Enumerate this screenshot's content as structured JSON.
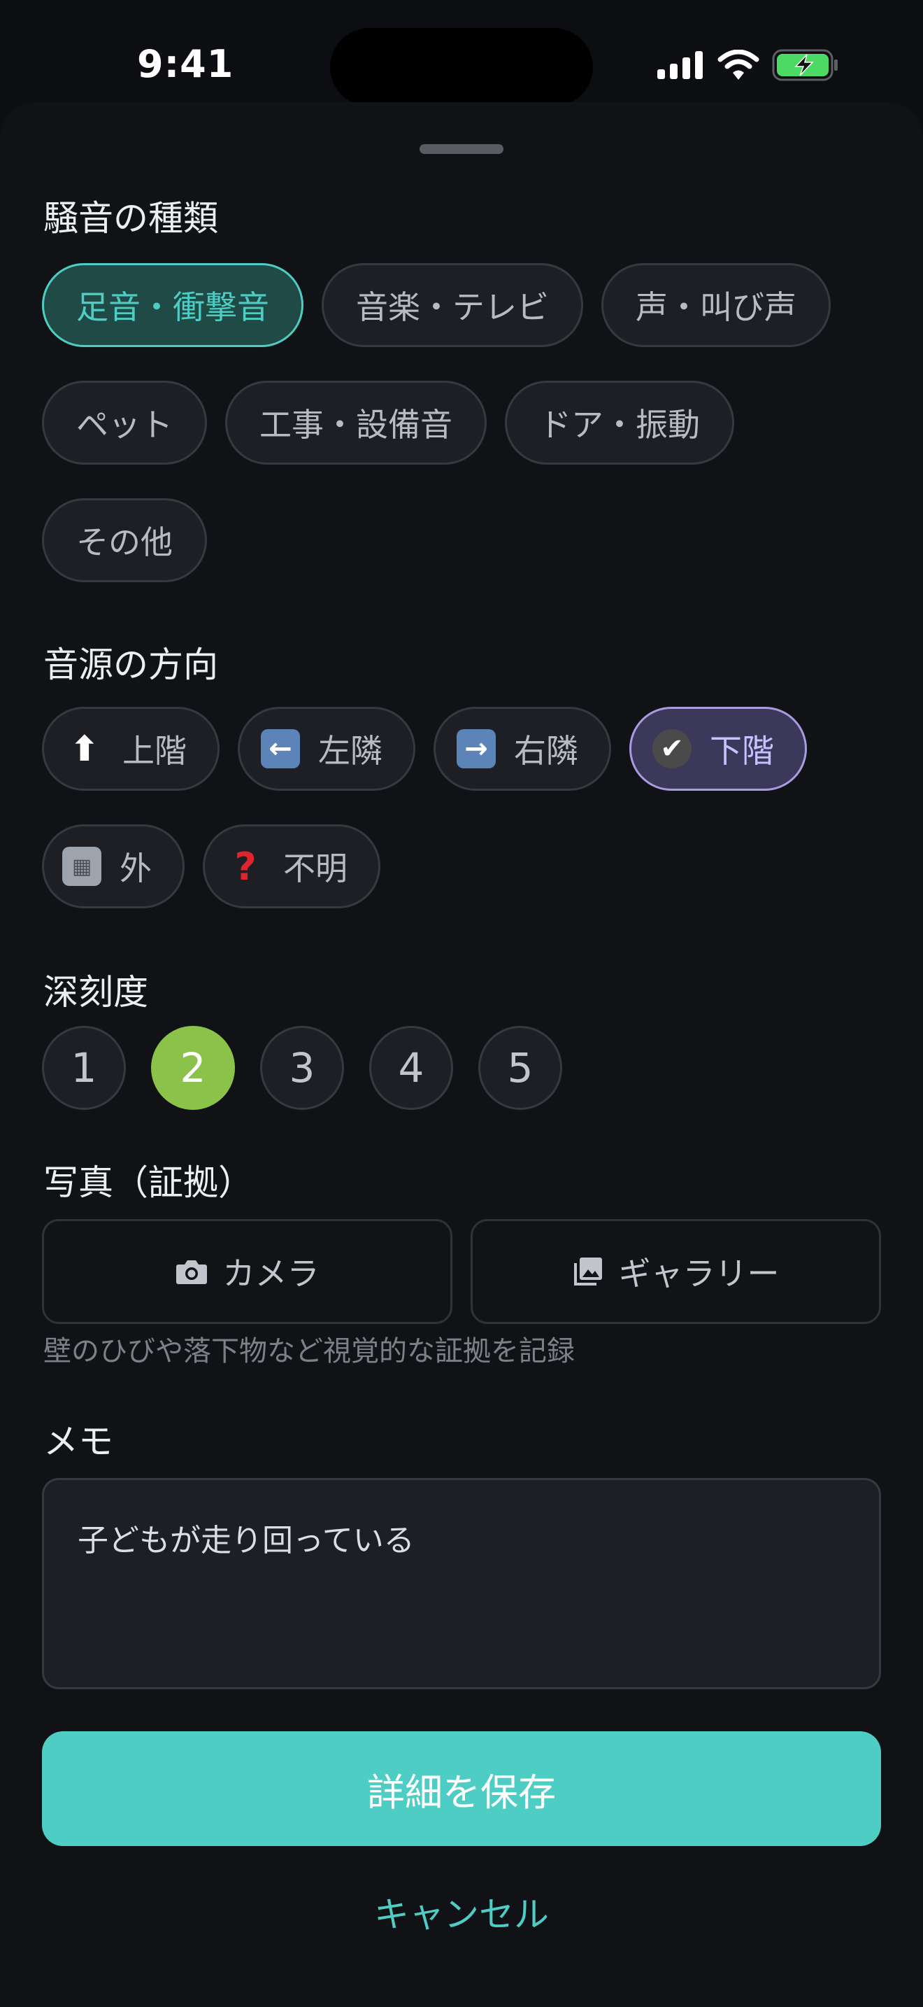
{
  "status_bar": {
    "time": "9:41"
  },
  "noise_type": {
    "title": "騒音の種類",
    "chips": [
      {
        "label": "足音・衝撃音",
        "selected": true
      },
      {
        "label": "音楽・テレビ",
        "selected": false
      },
      {
        "label": "声・叫び声",
        "selected": false
      },
      {
        "label": "ペット",
        "selected": false
      },
      {
        "label": "工事・設備音",
        "selected": false
      },
      {
        "label": "ドア・振動",
        "selected": false
      },
      {
        "label": "その他",
        "selected": false
      }
    ]
  },
  "direction": {
    "title": "音源の方向",
    "chips": [
      {
        "label": "上階",
        "icon": "up-arrow-icon",
        "selected": false
      },
      {
        "label": "左隣",
        "icon": "left-arrow-icon",
        "selected": false
      },
      {
        "label": "右隣",
        "icon": "right-arrow-icon",
        "selected": false
      },
      {
        "label": "下階",
        "icon": "check-box-icon",
        "selected": true
      },
      {
        "label": "外",
        "icon": "building-icon",
        "selected": false
      },
      {
        "label": "不明",
        "icon": "question-mark-icon",
        "selected": false
      }
    ]
  },
  "severity": {
    "title": "深刻度",
    "levels": [
      "1",
      "2",
      "3",
      "4",
      "5"
    ],
    "selected": "2"
  },
  "photo": {
    "title": "写真（証拠）",
    "camera_label": "カメラ",
    "gallery_label": "ギャラリー",
    "hint": "壁のひびや落下物など視覚的な証拠を記録"
  },
  "memo": {
    "title": "メモ",
    "value": "子どもが走り回っている"
  },
  "actions": {
    "save_label": "詳細を保存",
    "cancel_label": "キャンセル"
  },
  "colors": {
    "accent_teal": "#4ecdc4",
    "severity_active": "#8bc34a",
    "direction_active": "#a79ce0",
    "background": "#111215"
  }
}
